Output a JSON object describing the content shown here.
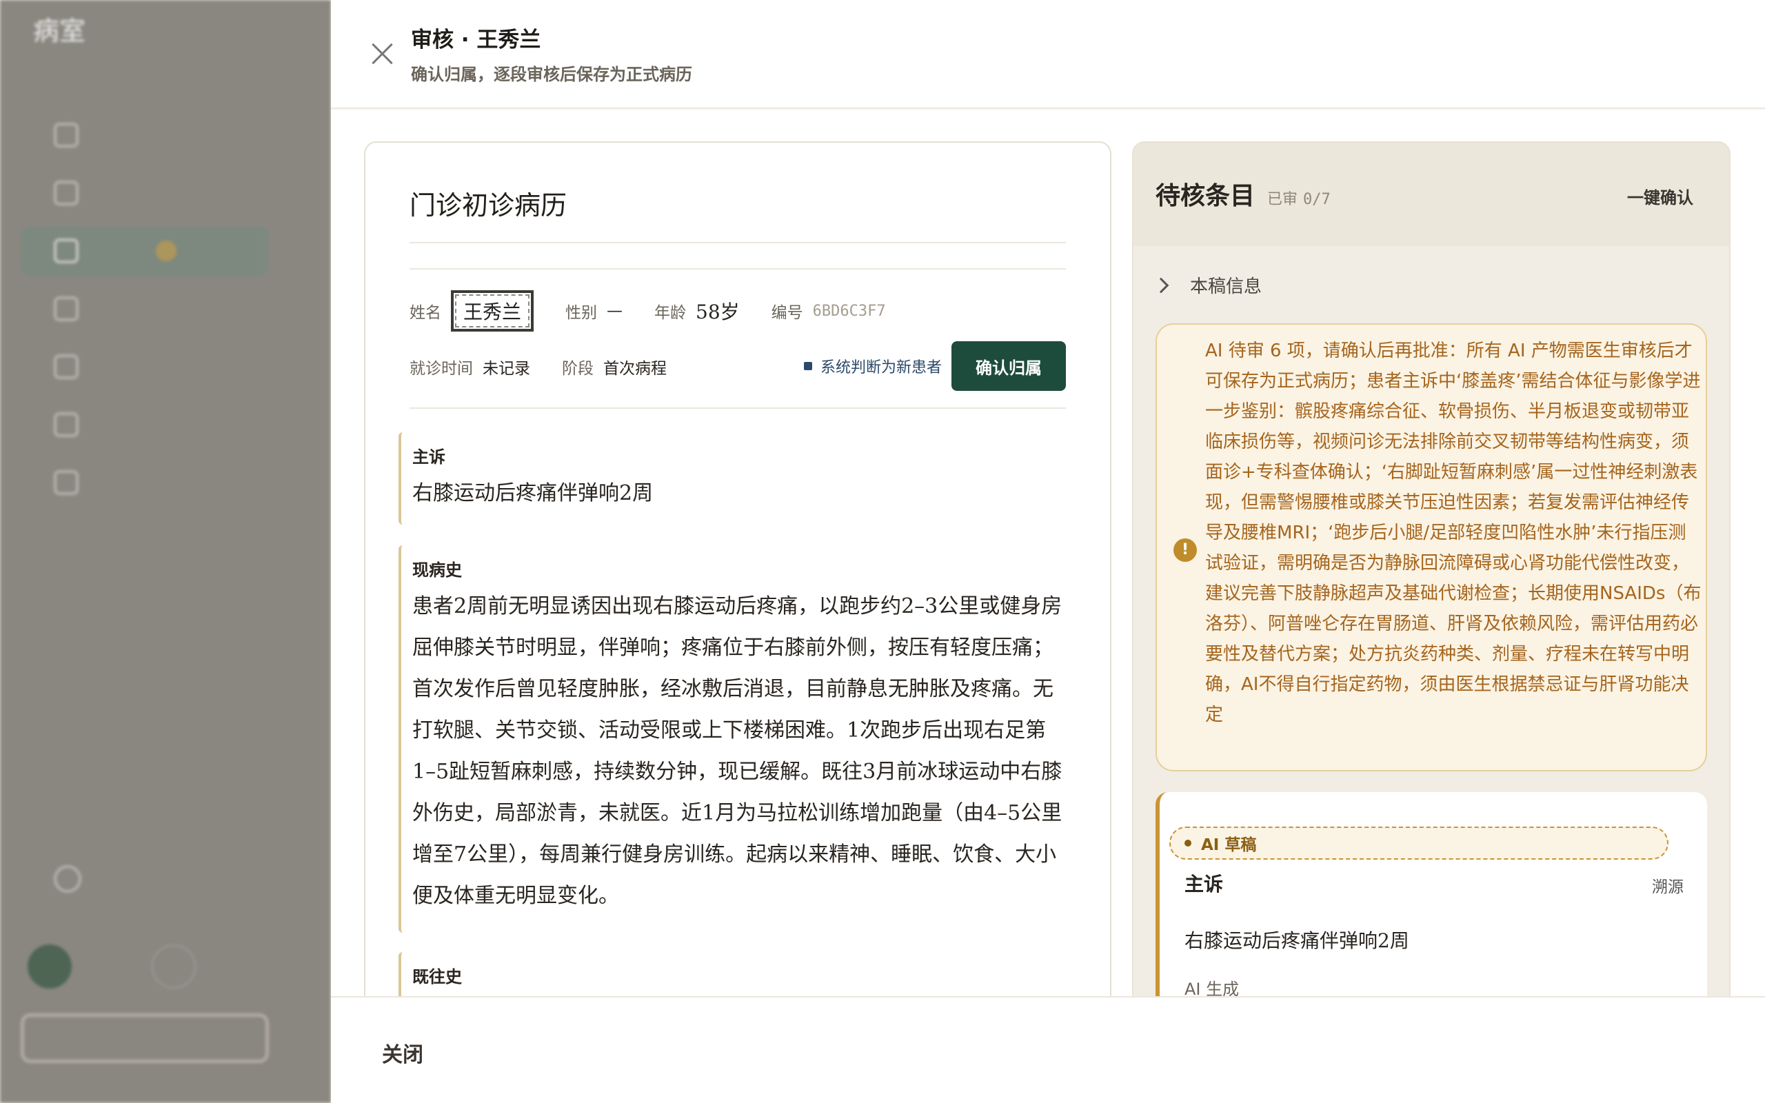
{
  "background": {
    "brand": "病室",
    "brand_sub": "",
    "nav_items": [
      "",
      "",
      "",
      "",
      "",
      "",
      ""
    ],
    "user_name": ""
  },
  "drawer": {
    "title": "审核 · 王秀兰",
    "subtitle": "确认归属，逐段审核后保存为正式病历",
    "close_label": "关闭"
  },
  "record": {
    "title": "门诊初诊病历",
    "patient": {
      "name_label": "姓名",
      "name": "王秀兰",
      "gender_label": "性别",
      "gender": "—",
      "age_label": "年龄",
      "age": "58岁",
      "id_label": "编号",
      "id": "6BD6C3F7",
      "visit_label": "就诊时间",
      "visit": "未记录",
      "stage_label": "阶段",
      "stage": "首次病程",
      "new_patient_note": "系统判断为新患者",
      "confirm_button": "确认归属"
    },
    "sections": [
      {
        "label": "主诉",
        "text": "右膝运动后疼痛伴弹响2周"
      },
      {
        "label": "现病史",
        "text": "患者2周前无明显诱因出现右膝运动后疼痛，以跑步约2–3公里或健身房屈伸膝关节时明显，伴弹响；疼痛位于右膝前外侧，按压有轻度压痛；首次发作后曾见轻度肿胀，经冰敷后消退，目前静息无肿胀及疼痛。无打软腿、关节交锁、活动受限或上下楼梯困难。1次跑步后出现右足第1–5趾短暂麻刺感，持续数分钟，现已缓解。既往3月前冰球运动中右膝外伤史，局部淤青，未就医。近1月为马拉松训练增加跑量（由4–5公里增至7公里），每周兼行健身房训练。起病以来精神、睡眠、饮食、大小便及体重无明显变化。"
      },
      {
        "label": "既往史",
        "text": ""
      }
    ]
  },
  "review": {
    "title": "待核条目",
    "reviewed_label": "已审",
    "reviewed_count": "0/7",
    "one_click": "一键确认",
    "info_label": "本稿信息",
    "warning": "AI 待审 6 项，请确认后再批准：所有 AI 产物需医生审核后才可保存为正式病历；患者主诉中‘膝盖疼’需结合体征与影像学进一步鉴别：髌股疼痛综合征、软骨损伤、半月板退变或韧带亚临床损伤等，视频问诊无法排除前交叉韧带等结构性病变，须面诊+专科查体确认；‘右脚趾短暂麻刺感’属一过性神经刺激表现，但需警惕腰椎或膝关节压迫性因素；若复发需评估神经传导及腰椎MRI；‘跑步后小腿/足部轻度凹陷性水肿’未行指压测试验证，需明确是否为静脉回流障碍或心肾功能代偿性改变，建议完善下肢静脉超声及基础代谢检查；长期使用NSAIDs（布洛芬）、阿普唑仑存在胃肠道、肝肾及依赖风险，需评估用药必要性及替代方案；处方抗炎药种类、剂量、疗程未在转写中明确，AI不得自行指定药物，须由医生根据禁忌证与肝肾功能决定",
    "draft": {
      "tag": "AI 草稿",
      "label": "主诉",
      "trace": "溯源",
      "text": "右膝运动后疼痛伴弹响2周",
      "source": "AI 生成"
    }
  },
  "colors": {
    "primary": "#1e4c3c",
    "accent": "#c99533",
    "warning_text": "#a5651e"
  }
}
